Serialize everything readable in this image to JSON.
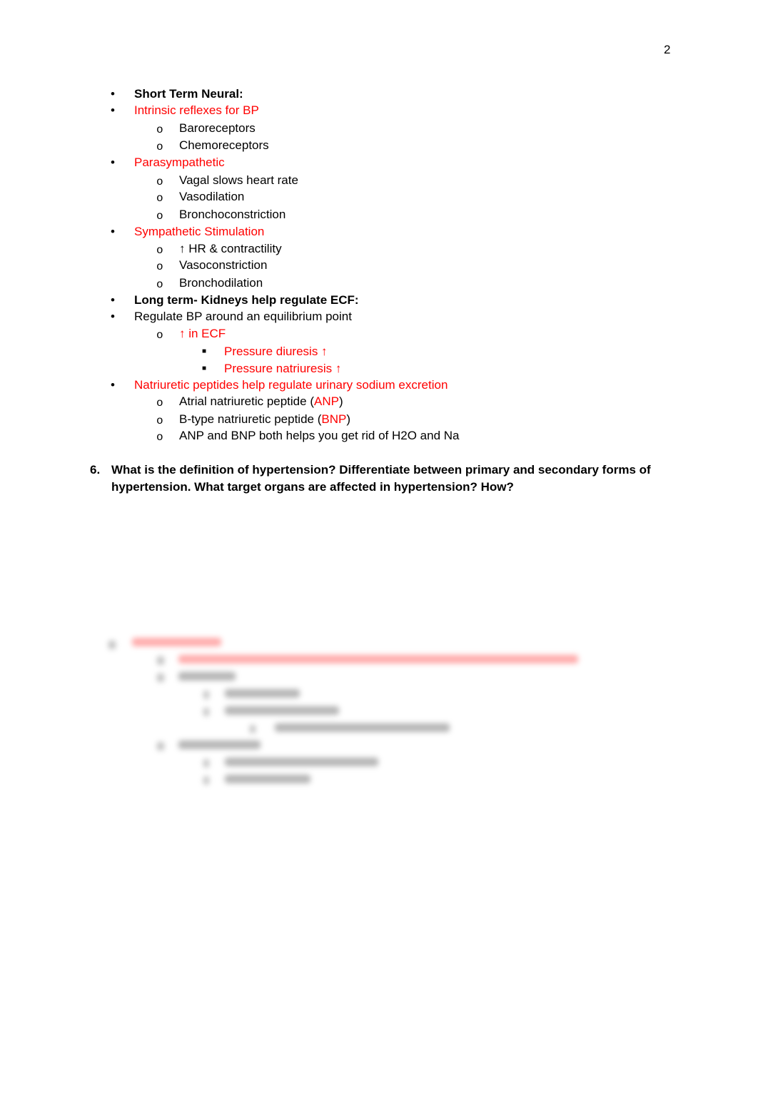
{
  "page": {
    "number": "2"
  },
  "outline": [
    {
      "level": 1,
      "marker": "•",
      "text": "Short Term Neural:",
      "style": "bold"
    },
    {
      "level": 1,
      "marker": "•",
      "text": "Intrinsic reflexes for BP",
      "style": "red"
    },
    {
      "level": 2,
      "marker": "o",
      "text": "Baroreceptors",
      "style": "normal"
    },
    {
      "level": 2,
      "marker": "o",
      "text": "Chemoreceptors",
      "style": "normal"
    },
    {
      "level": 1,
      "marker": "•",
      "text": "Parasympathetic",
      "style": "red"
    },
    {
      "level": 2,
      "marker": "o",
      "text": "Vagal slows heart rate",
      "style": "normal"
    },
    {
      "level": 2,
      "marker": "o",
      "text": "Vasodilation",
      "style": "normal"
    },
    {
      "level": 2,
      "marker": "o",
      "text": "Bronchoconstriction",
      "style": "normal"
    },
    {
      "level": 1,
      "marker": "•",
      "text": "Sympathetic Stimulation",
      "style": "red"
    },
    {
      "level": 2,
      "marker": "o",
      "text": "↑ HR & contractility",
      "style": "normal"
    },
    {
      "level": 2,
      "marker": "o",
      "text": "Vasoconstriction",
      "style": "normal"
    },
    {
      "level": 2,
      "marker": "o",
      "text": "Bronchodilation",
      "style": "normal"
    },
    {
      "level": 1,
      "marker": "•",
      "text": "Long term- Kidneys help regulate ECF:",
      "style": "bold"
    },
    {
      "level": 1,
      "marker": "•",
      "text": "Regulate BP around an equilibrium point",
      "style": "normal"
    },
    {
      "level": 2,
      "marker": "o",
      "text": "↑ in ECF",
      "style": "red"
    },
    {
      "level": 3,
      "marker": "■",
      "text": "Pressure diuresis ↑",
      "style": "red"
    },
    {
      "level": 3,
      "marker": "■",
      "text": "Pressure natriuresis ↑",
      "style": "red"
    },
    {
      "level": 1,
      "marker": "•",
      "text": "Natriuretic peptides help regulate urinary sodium excretion",
      "style": "red"
    },
    {
      "level": 2,
      "marker": "o",
      "text_before": "Atrial natriuretic peptide (",
      "highlight": "ANP",
      "text_after": ")",
      "style": "mixed"
    },
    {
      "level": 2,
      "marker": "o",
      "text_before": "B-type natriuretic peptide (",
      "highlight": "BNP",
      "text_after": ")",
      "style": "mixed"
    },
    {
      "level": 2,
      "marker": "o",
      "text": "ANP and BNP both helps you get rid of H2O and Na",
      "style": "normal"
    }
  ],
  "question": {
    "number": "6.",
    "line1": "What is the definition of hypertension?  Differentiate between primary and secondary forms of",
    "line2": "hypertension.  What target organs are affected in hypertension?  How?"
  },
  "colors": {
    "accent_red": "#ff0000",
    "text": "#000000"
  }
}
